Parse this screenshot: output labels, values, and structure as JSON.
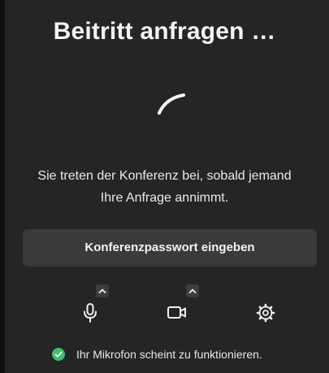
{
  "title": "Beitritt anfragen …",
  "message_line1": "Sie treten der Konferenz bei, sobald jemand",
  "message_line2": "Ihre Anfrage annimmt.",
  "password_button_label": "Konferenzpasswort eingeben",
  "controls": {
    "microphone_icon": "microphone-icon",
    "camera_icon": "camera-icon",
    "settings_icon": "gear-icon"
  },
  "status": {
    "text": "Ihr Mikrofon scheint zu funktionieren.",
    "icon": "check-circle-icon",
    "color": "#3fbf6a"
  }
}
